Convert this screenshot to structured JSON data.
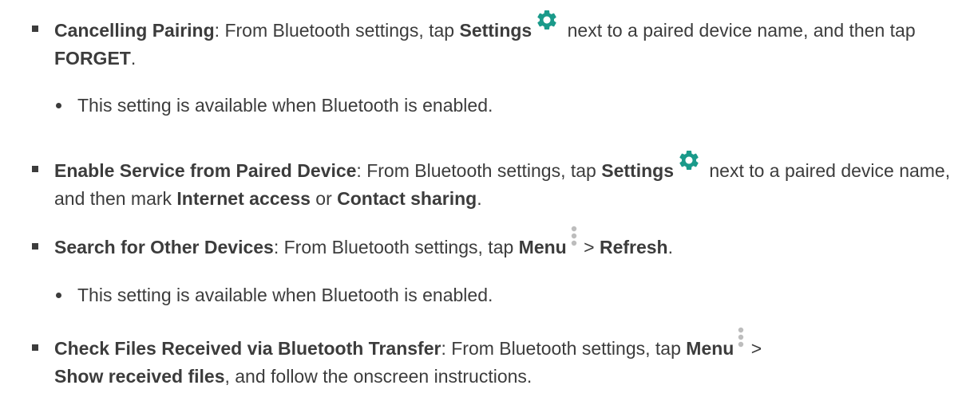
{
  "items": [
    {
      "title": "Cancelling Pairing",
      "sep": ": ",
      "t1": "From Bluetooth settings, tap ",
      "b1": "Settings",
      "t2": " next to a paired device name, and then tap ",
      "b2": "FORGET",
      "t3": "."
    },
    {
      "note": "This setting is available when Bluetooth is enabled."
    },
    {
      "title": "Enable Service from Paired Device",
      "sep": ": ",
      "t1": "From Bluetooth settings, tap ",
      "b1": "Settings",
      "t2": " next to a paired device name, and then mark ",
      "b2": "Internet access",
      "t3": " or ",
      "b3": "Contact sharing",
      "t4": "."
    },
    {
      "title": "Search for Other Devices",
      "sep": ": ",
      "t1": "From Bluetooth settings, tap ",
      "b1": "Menu",
      "t2": " > ",
      "b2": "Refresh",
      "t3": "."
    },
    {
      "note": "This setting is available when Bluetooth is enabled."
    },
    {
      "title": "Check Files Received via Bluetooth Transfer",
      "sep": ": ",
      "t1": "From Bluetooth settings, tap ",
      "b1": "Menu",
      "t2": " > ",
      "b2": "Show received files",
      "t3": ", and follow the onscreen instructions."
    }
  ],
  "colors": {
    "text": "#3c3c3c",
    "gear_icon": "#1a9a8a",
    "menu_icon": "#bdbdbd"
  },
  "icons": [
    "settings-gear-icon",
    "menu-kebab-icon"
  ]
}
